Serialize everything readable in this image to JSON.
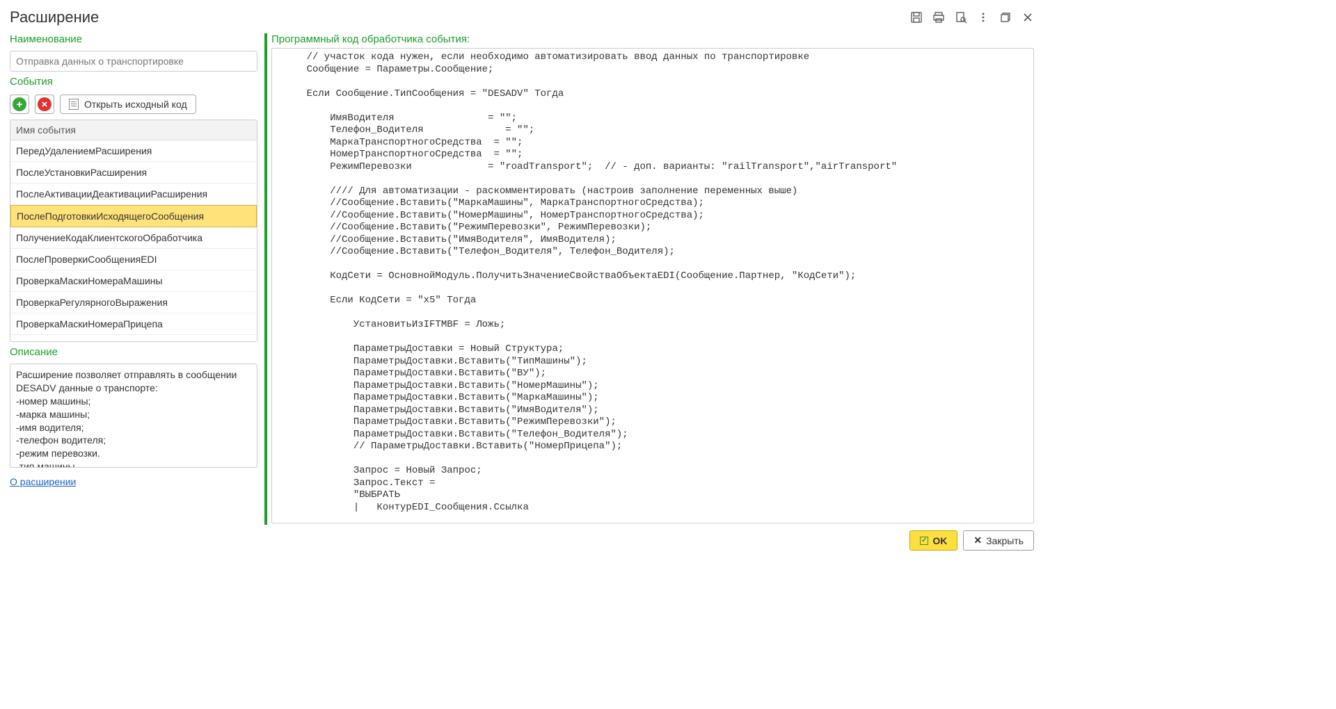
{
  "window_title": "Расширение",
  "labels": {
    "name": "Наименование",
    "events": "События",
    "open_source": "Открыть исходный код",
    "events_header": "Имя события",
    "description": "Описание",
    "about": "О расширении",
    "code_header": "Программный код обработчика события:",
    "ok": "OK",
    "close": "Закрыть"
  },
  "name_value": "Отправка данных о транспортировке",
  "events_list": [
    "ПередУдалениемРасширения",
    "ПослеУстановкиРасширения",
    "ПослеАктивацииДеактивацииРасширения",
    "ПослеПодготовкиИсходящегоСообщения",
    "ПолучениеКодаКлиентскогоОбработчика",
    "ПослеПроверкиСообщенияEDI",
    "ПроверкаМаскиНомераМашины",
    "ПроверкаРегулярногоВыражения",
    "ПроверкаМаскиНомераПрицепа"
  ],
  "selected_event_index": 3,
  "description_text": "Расширение позволяет отправлять в сообщении DESADV данные о транспорте:\n-номер машины;\n-марка машины;\n-имя водителя;\n-телефон водителя;\n-режим перевозки.\n-тип машины",
  "code": "    // участок кода нужен, если необходимо автоматизировать ввод данных по транспортировке\n    Сообщение = Параметры.Сообщение;\n\n    Если Сообщение.ТипСообщения = \"DESADV\" Тогда\n\n        ИмяВодителя                = \"\";\n        Телефон_Водителя              = \"\";\n        МаркаТранспортногоСредства  = \"\";\n        НомерТранспортногоСредства  = \"\";\n        РежимПеревозки             = \"roadTransport\";  // - доп. варианты: \"railTransport\",\"airTransport\"\n\n        //// Для автоматизации - раскомментировать (настроив заполнение переменных выше)\n        //Сообщение.Вставить(\"МаркаМашины\", МаркаТранспортногоСредства);\n        //Сообщение.Вставить(\"НомерМашины\", НомерТранспортногоСредства);\n        //Сообщение.Вставить(\"РежимПеревозки\", РежимПеревозки);\n        //Сообщение.Вставить(\"ИмяВодителя\", ИмяВодителя);\n        //Сообщение.Вставить(\"Телефон_Водителя\", Телефон_Водителя);\n\n        КодСети = ОсновнойМодуль.ПолучитьЗначениеСвойстваОбъектаEDI(Сообщение.Партнер, \"КодСети\");\n\n        Если КодСети = \"x5\" Тогда\n\n            УстановитьИзIFTMBF = Ложь;\n\n            ПараметрыДоставки = Новый Структура;\n            ПараметрыДоставки.Вставить(\"ТипМашины\");\n            ПараметрыДоставки.Вставить(\"ВУ\");\n            ПараметрыДоставки.Вставить(\"НомерМашины\");\n            ПараметрыДоставки.Вставить(\"МаркаМашины\");\n            ПараметрыДоставки.Вставить(\"ИмяВодителя\");\n            ПараметрыДоставки.Вставить(\"РежимПеревозки\");\n            ПараметрыДоставки.Вставить(\"Телефон_Водителя\");\n            // ПараметрыДоставки.Вставить(\"НомерПрицепа\");\n\n            Запрос = Новый Запрос;\n            Запрос.Текст =\n            \"ВЫБРАТЬ\n            |   КонтурEDI_Сообщения.Ссылка"
}
